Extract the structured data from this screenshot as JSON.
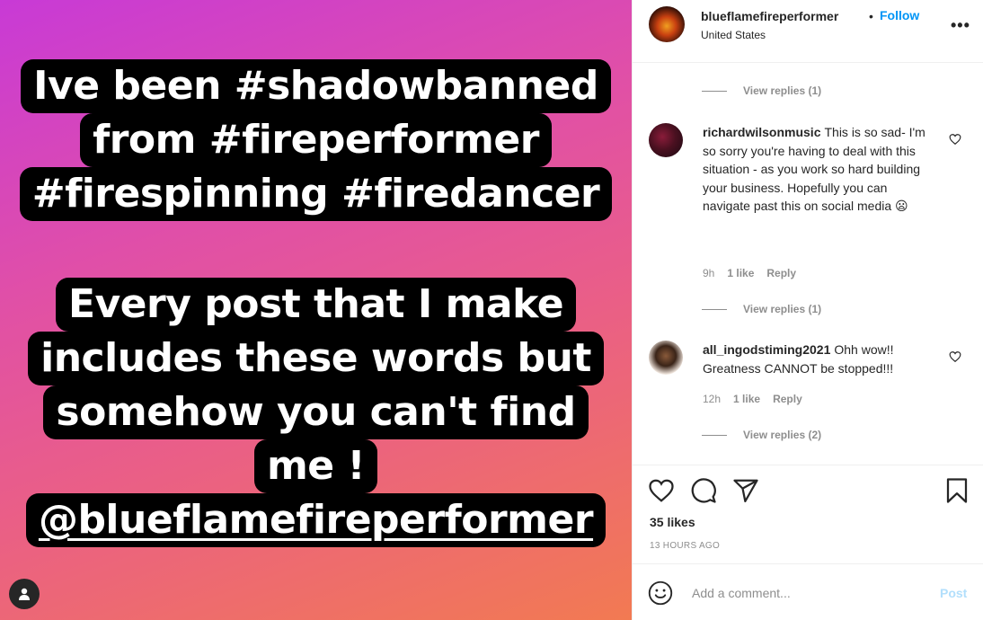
{
  "story": {
    "block1": [
      "Ive been #shadowbanned",
      "from #fireperformer",
      "#firespinning #firedancer"
    ],
    "block2": [
      "Every post that I make",
      "includes these words but",
      "somehow you can't find",
      "me !"
    ],
    "mention": "@blueflamefireperformer"
  },
  "header": {
    "username": "blueflamefireperformer",
    "separator": "•",
    "follow_label": "Follow",
    "location": "United States",
    "more_label": "•••"
  },
  "comments": {
    "view_replies_top": "View replies (1)",
    "items": [
      {
        "username": "richardwilsonmusic",
        "text": "This is so sad- I'm so sorry you're having to deal with this situation - as you work so hard building your business. Hopefully you can navigate past this on social media 😦",
        "time": "9h",
        "likes": "1 like",
        "reply_label": "Reply",
        "view_replies": "View replies (1)"
      },
      {
        "username": "all_ingodstiming2021",
        "text": "Ohh wow!! Greatness CANNOT be stopped!!!",
        "time": "12h",
        "likes": "1 like",
        "reply_label": "Reply",
        "view_replies": "View replies (2)"
      }
    ]
  },
  "actions": {
    "likes": "35 likes",
    "timestamp": "13 HOURS AGO"
  },
  "comment_bar": {
    "placeholder": "Add a comment...",
    "post_label": "Post"
  },
  "colors": {
    "follow_blue": "#0095f6",
    "post_disabled": "#b2dffc",
    "muted": "#8e8e8e",
    "gradient_start": "#c83ad6",
    "gradient_end": "#f27a52"
  },
  "icons": [
    "user-tag-icon",
    "heart-icon",
    "comment-icon",
    "share-icon",
    "bookmark-icon",
    "emoji-icon",
    "more-options-icon"
  ]
}
